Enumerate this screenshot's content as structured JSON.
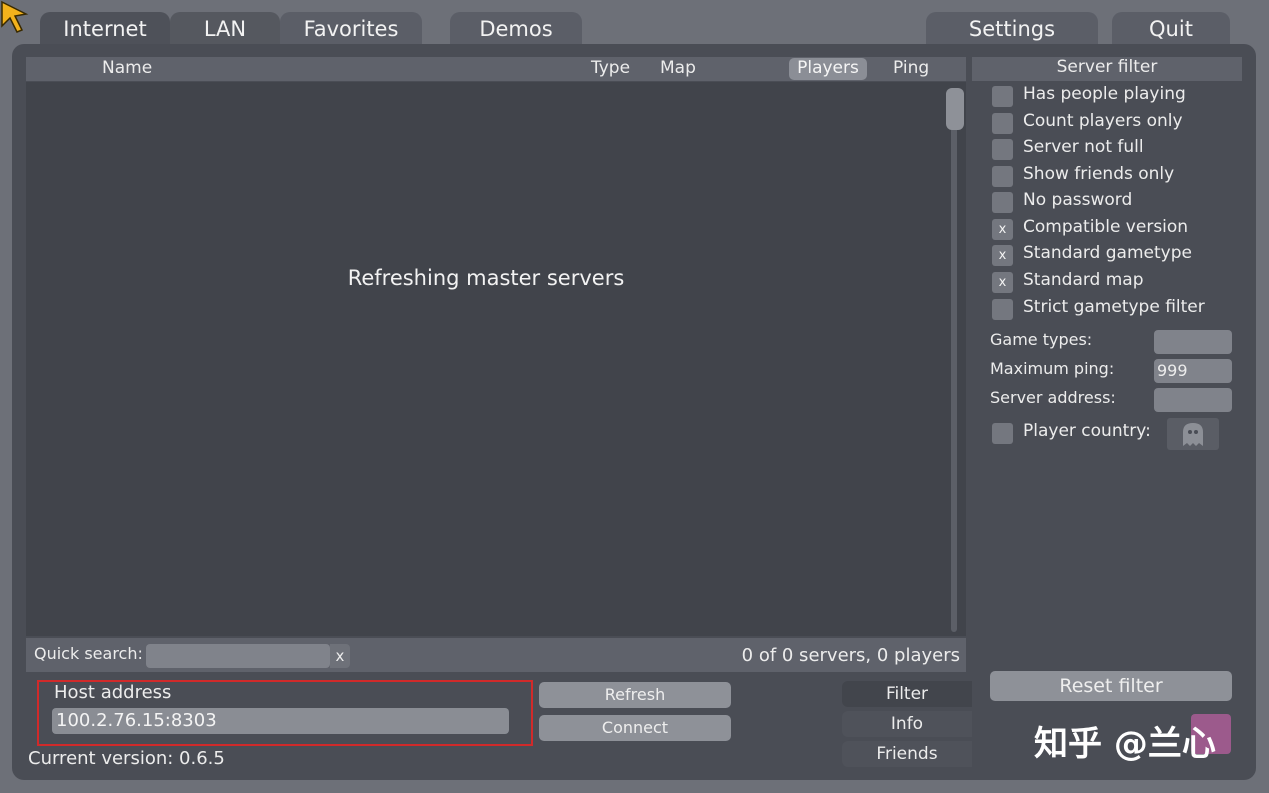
{
  "tabs": [
    "Internet",
    "LAN",
    "Favorites",
    "Demos",
    "Settings",
    "Quit"
  ],
  "columns": [
    "Name",
    "Type",
    "Map",
    "Players",
    "Ping"
  ],
  "list_message": "Refreshing master servers",
  "quick_search": {
    "label": "Quick search:",
    "value": "",
    "clear": "x"
  },
  "status_count": "0 of 0 servers, 0 players",
  "host": {
    "label": "Host address",
    "value": "100.2.76.15:8303"
  },
  "buttons": {
    "refresh": "Refresh",
    "connect": "Connect"
  },
  "side_tabs": [
    "Filter",
    "Info",
    "Friends"
  ],
  "version": "Current version: 0.6.5",
  "filter": {
    "title": "Server filter",
    "options": [
      {
        "label": "Has people playing",
        "checked": false
      },
      {
        "label": "Count players only",
        "checked": false
      },
      {
        "label": "Server not full",
        "checked": false
      },
      {
        "label": "Show friends only",
        "checked": false
      },
      {
        "label": "No password",
        "checked": false
      },
      {
        "label": "Compatible version",
        "checked": true
      },
      {
        "label": "Standard gametype",
        "checked": true
      },
      {
        "label": "Standard map",
        "checked": true
      },
      {
        "label": "Strict gametype filter",
        "checked": false
      }
    ],
    "check_mark": "x",
    "game_types_label": "Game types:",
    "game_types_value": "",
    "max_ping_label": "Maximum ping:",
    "max_ping_value": "999",
    "server_address_label": "Server address:",
    "server_address_value": "",
    "player_country_label": "Player country:",
    "reset_label": "Reset filter"
  },
  "watermark": "知乎 @兰心"
}
